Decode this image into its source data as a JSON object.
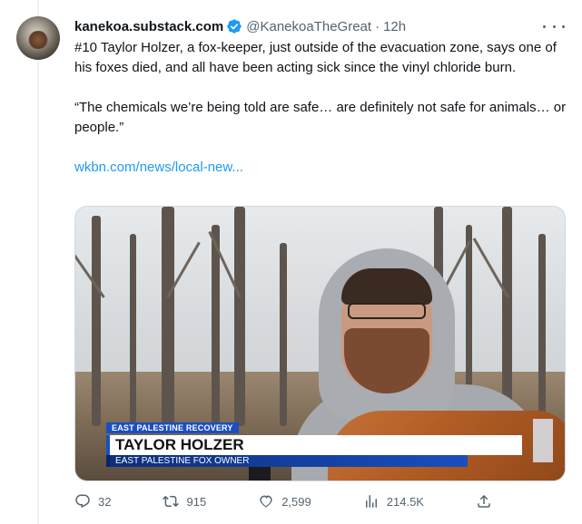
{
  "tweet": {
    "display_name": "kanekoa.substack.com",
    "handle": "@KanekoaTheGreat",
    "separator": "·",
    "time": "12h",
    "paragraphs": [
      "#10 Taylor Holzer, a fox-keeper, just outside of the evacuation zone, says one of his foxes died, and all have been acting sick since the vinyl chloride burn.",
      "“The chemicals we’re being told are safe… are definitely not safe for animals… or people.”"
    ],
    "link_text": "wkbn.com/news/local-new..."
  },
  "media": {
    "lower_third": {
      "tag": "EAST PALESTINE RECOVERY",
      "name": "TAYLOR HOLZER",
      "title": "EAST PALESTINE FOX OWNER"
    }
  },
  "actions": {
    "replies": "32",
    "retweets": "915",
    "likes": "2,599",
    "views": "214.5K"
  },
  "colors": {
    "accent": "#1d9bf0",
    "secondary_text": "#536471",
    "broadcast_blue": "#1a4fbf"
  },
  "icons": [
    "verified-badge-icon",
    "more-icon",
    "reply-icon",
    "retweet-icon",
    "like-icon",
    "views-icon",
    "share-icon"
  ]
}
